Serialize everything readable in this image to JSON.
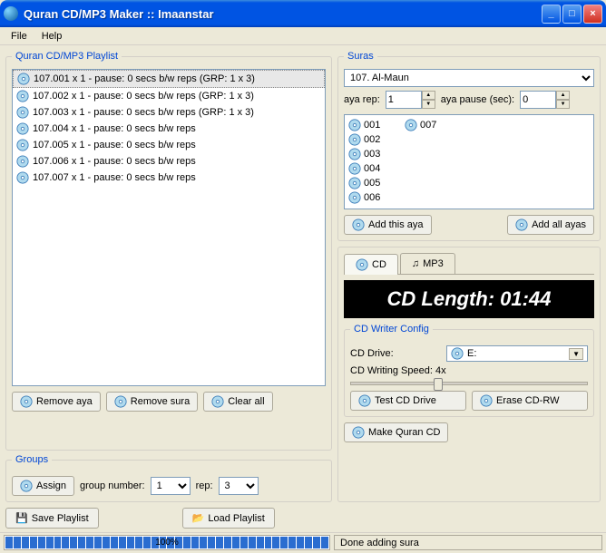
{
  "window": {
    "title": "Quran CD/MP3 Maker :: Imaanstar"
  },
  "menu": {
    "file": "File",
    "help": "Help"
  },
  "playlist": {
    "legend": "Quran CD/MP3 Playlist",
    "items": [
      "107.001 x 1 - pause: 0 secs b/w reps (GRP: 1 x 3)",
      "107.002 x 1 - pause: 0 secs b/w reps (GRP: 1 x 3)",
      "107.003 x 1 - pause: 0 secs b/w reps (GRP: 1 x 3)",
      "107.004 x 1 - pause: 0 secs b/w reps",
      "107.005 x 1 - pause: 0 secs b/w reps",
      "107.006 x 1 - pause: 0 secs b/w reps",
      "107.007 x 1 - pause: 0 secs b/w reps"
    ],
    "removeAya": "Remove aya",
    "removeSura": "Remove sura",
    "clearAll": "Clear all"
  },
  "groups": {
    "legend": "Groups",
    "assign": "Assign",
    "groupNumberLabel": "group number:",
    "groupNumber": "1",
    "repLabel": "rep:",
    "rep": "3"
  },
  "save": "Save Playlist",
  "load": "Load Playlist",
  "suras": {
    "legend": "Suras",
    "selected": "107. Al-Maun",
    "ayaRepLabel": "aya rep:",
    "ayaRep": "1",
    "ayaPauseLabel": "aya pause (sec):",
    "ayaPause": "0",
    "ayas": [
      "001",
      "002",
      "003",
      "004",
      "005",
      "006",
      "007"
    ],
    "addThis": "Add this aya",
    "addAll": "Add all ayas"
  },
  "tabs": {
    "cd": "CD",
    "mp3": "MP3"
  },
  "cdLength": "CD Length: 01:44",
  "writer": {
    "legend": "CD Writer Config",
    "driveLabel": "CD Drive:",
    "drive": "E:",
    "speedLabel": "CD Writing Speed: 4x",
    "test": "Test CD Drive",
    "erase": "Erase CD-RW"
  },
  "make": "Make Quran CD",
  "status": {
    "percent": "100%",
    "text": "Done adding sura"
  }
}
